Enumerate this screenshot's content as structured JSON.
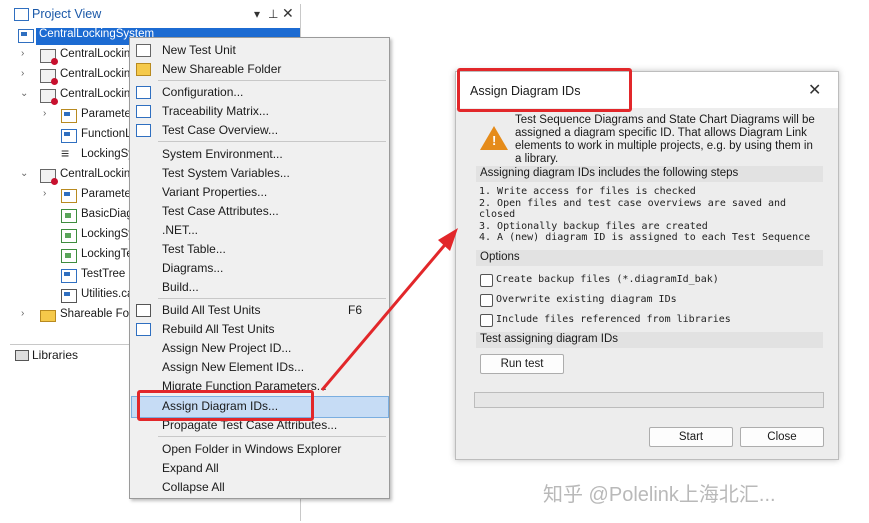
{
  "project_view": {
    "title": "Project View",
    "title_icons": [
      "dropdown-icon",
      "pin-icon",
      "close-icon"
    ],
    "tree": [
      {
        "label": "CentralLockingSystem",
        "icon": "project-icon",
        "selected": true
      },
      {
        "label": "CentralLocking",
        "icon": "test-unit-icon"
      },
      {
        "label": "CentralLocking",
        "icon": "test-unit-icon"
      },
      {
        "label": "CentralLocking",
        "icon": "test-unit-icon"
      },
      {
        "label": "Paramete",
        "icon": "parameter-icon"
      },
      {
        "label": "FunctionL",
        "icon": "table-icon"
      },
      {
        "label": "LockingSy",
        "icon": "flow-icon"
      },
      {
        "label": "CentralLocking",
        "icon": "test-unit-icon"
      },
      {
        "label": "Paramete",
        "icon": "parameter-icon"
      },
      {
        "label": "BasicDiag",
        "icon": "diagram-icon"
      },
      {
        "label": "LockingSy",
        "icon": "diagram-icon"
      },
      {
        "label": "LockingTe",
        "icon": "diagram-icon"
      },
      {
        "label": "TestTree",
        "icon": "table-icon"
      },
      {
        "label": "Utilities.ca",
        "icon": "library-icon"
      },
      {
        "label": "Shareable Fol",
        "icon": "shareable-folder-icon"
      }
    ]
  },
  "libraries": {
    "title": "Libraries"
  },
  "context_menu": {
    "items": [
      {
        "label": "New Test Unit"
      },
      {
        "label": "New Shareable Folder"
      },
      {
        "label": "Configuration..."
      },
      {
        "label": "Traceability Matrix..."
      },
      {
        "label": "Test Case Overview..."
      },
      {
        "label": "System Environment..."
      },
      {
        "label": "Test System Variables..."
      },
      {
        "label": "Variant Properties..."
      },
      {
        "label": "Test Case Attributes..."
      },
      {
        "label": ".NET..."
      },
      {
        "label": "Test Table..."
      },
      {
        "label": "Diagrams..."
      },
      {
        "label": "Build..."
      },
      {
        "label": "Build All Test Units",
        "shortcut": "F6"
      },
      {
        "label": "Rebuild All Test Units"
      },
      {
        "label": "Assign New Project ID..."
      },
      {
        "label": "Assign New Element IDs..."
      },
      {
        "label": "Migrate Function Parameters..."
      },
      {
        "label": "Assign Diagram IDs...",
        "highlighted": true
      },
      {
        "label": "Propagate Test Case Attributes..."
      },
      {
        "label": "Open Folder in Windows Explorer"
      },
      {
        "label": "Expand All"
      },
      {
        "label": "Collapse All"
      }
    ]
  },
  "dialog": {
    "title": "Assign Diagram IDs",
    "intro": "Test Sequence Diagrams and State Chart Diagrams will be assigned a diagram specific ID. That allows Diagram Link elements to work in multiple projects, e.g. by using them in a library.",
    "steps_header": "Assigning diagram IDs includes the following steps",
    "steps": [
      "1. Write access for files is checked",
      "2. Open files and test case overviews are saved and closed",
      "3. Optionally backup files are created",
      "4. A (new) diagram ID is assigned to each Test Sequence"
    ],
    "options_header": "Options",
    "options": [
      {
        "label": "Create backup files (*.diagramId_bak)",
        "checked": false
      },
      {
        "label": "Overwrite existing diagram IDs",
        "checked": false
      },
      {
        "label": "Include files referenced from libraries",
        "checked": false
      }
    ],
    "test_header": "Test assigning diagram IDs",
    "run_test_label": "Run test",
    "start_label": "Start",
    "close_label": "Close",
    "progress": 0
  },
  "watermark": "知乎 @Polelink上海北汇...",
  "colors": {
    "highlight": "#e2272a",
    "selection": "#1c6bd2",
    "menu_hover": "#c6dcf5"
  }
}
